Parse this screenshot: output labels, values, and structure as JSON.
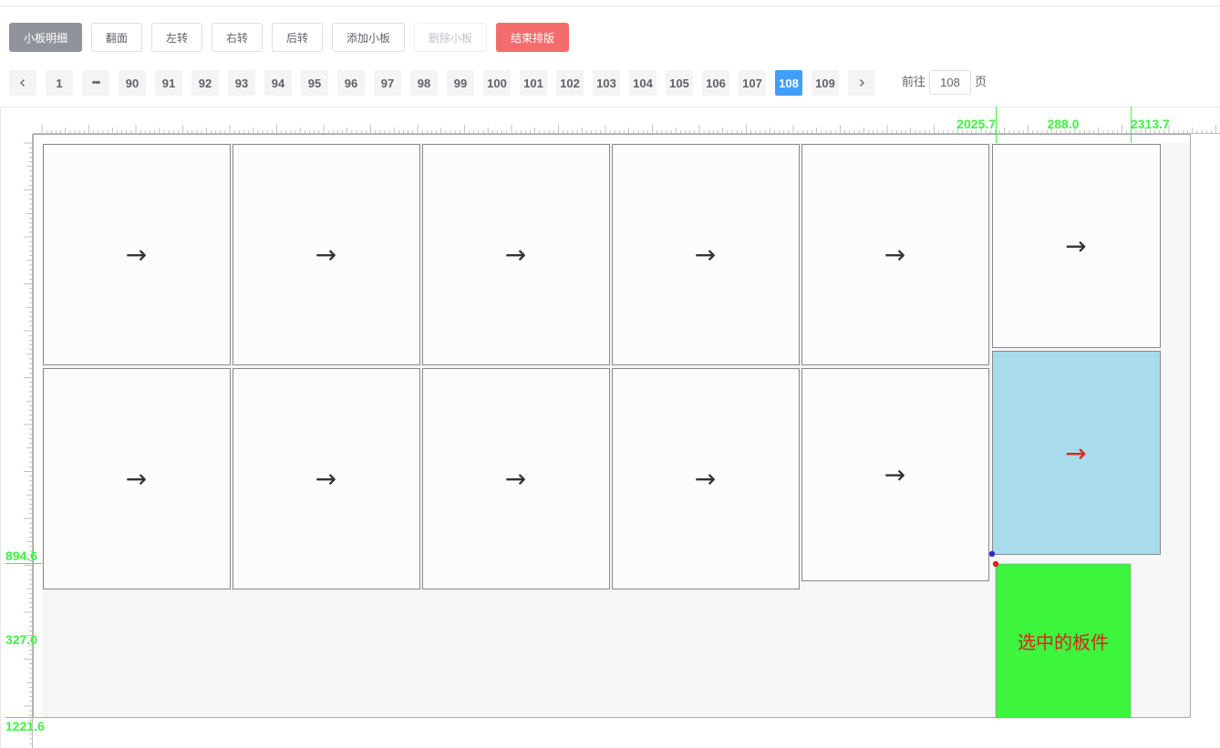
{
  "toolbar": {
    "detail_label": "小板明细",
    "flip_label": "翻面",
    "rotate_left_label": "左转",
    "rotate_right_label": "右转",
    "rotate_back_label": "后转",
    "add_panel_label": "添加小板",
    "delete_panel_label": "删除小板",
    "finish_label": "结束排版"
  },
  "pagination": {
    "first_page": "1",
    "ellipsis": "•••",
    "pages": [
      "90",
      "91",
      "92",
      "93",
      "94",
      "95",
      "96",
      "97",
      "98",
      "99",
      "100",
      "101",
      "102",
      "103",
      "104",
      "105",
      "106",
      "107",
      "108",
      "109"
    ],
    "current_page": "108",
    "goto_prefix": "前往",
    "goto_value": "108",
    "goto_suffix": "页"
  },
  "ruler": {
    "top_left_value": "2025.7",
    "top_width_value": "288.0",
    "top_right_value": "2313.7",
    "left_top_value": "894.6",
    "left_height_value": "327.0",
    "left_bottom_value": "1221.6"
  },
  "board": {
    "arrow_glyph": "→",
    "selected_label": "选中的板件",
    "colors": {
      "selected_fill": "#3df53d",
      "selected_text": "#e02020",
      "highlight_fill": "#a8dcec",
      "highlight_arrow": "#e02020",
      "panel_fill": "#fcfcfc",
      "board_fill": "#f6f6f6",
      "marker_blue": "#2b2bd6",
      "marker_red": "#e02020",
      "guide_green": "#3df53d"
    }
  }
}
